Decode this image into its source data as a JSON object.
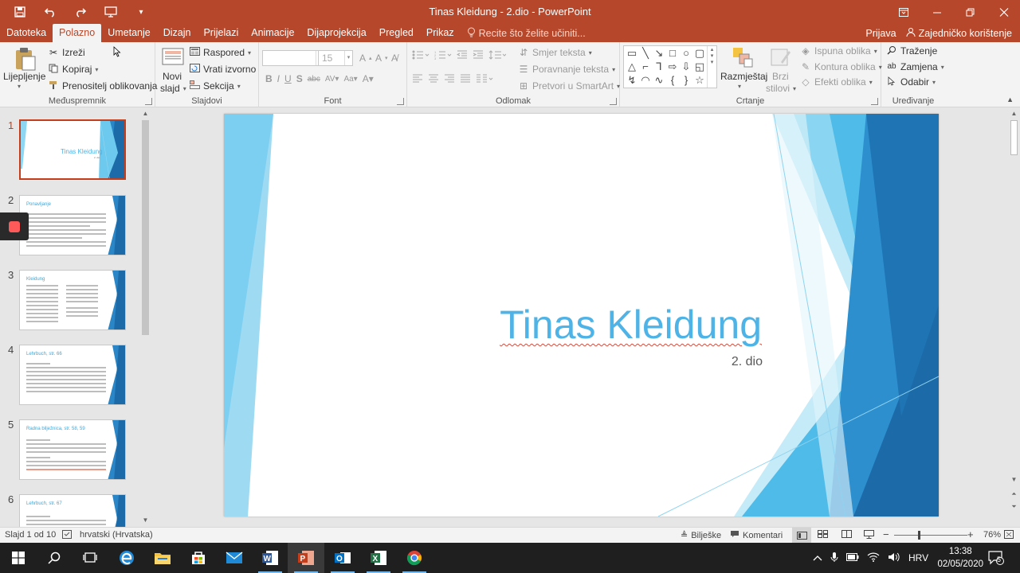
{
  "titlebar": {
    "title": "Tinas Kleidung - 2.dio - PowerPoint",
    "qat": [
      "save-icon",
      "undo-icon",
      "redo-icon",
      "present-icon",
      "customize-icon"
    ]
  },
  "tabs": [
    "Datoteka",
    "Polazno",
    "Umetanje",
    "Dizajn",
    "Prijelazi",
    "Animacije",
    "Dijaprojekcija",
    "Pregled",
    "Prikaz"
  ],
  "active_tab": "Polazno",
  "tellme": "Recite što želite učiniti...",
  "account": {
    "signin": "Prijava",
    "share": "Zajedničko korištenje"
  },
  "ribbon": {
    "clipboard": {
      "paste": "Lijepljenje",
      "cut": "Izreži",
      "copy": "Kopiraj",
      "format_painter": "Prenositelj oblikovanja",
      "label": "Međuspremnik"
    },
    "slides": {
      "new_slide_1": "Novi",
      "new_slide_2": "slajd",
      "layout": "Raspored",
      "reset": "Vrati izvorno",
      "section": "Sekcija",
      "label": "Slajdovi"
    },
    "font": {
      "size": "15",
      "label": "Font"
    },
    "paragraph": {
      "text_direction": "Smjer teksta",
      "align_text": "Poravnanje teksta",
      "smartart": "Pretvori u SmartArt",
      "label": "Odlomak"
    },
    "drawing": {
      "arrange": "Razmještaj",
      "quick_styles_1": "Brzi",
      "quick_styles_2": "stilovi",
      "shape_fill": "Ispuna oblika",
      "shape_outline": "Kontura oblika",
      "shape_effects": "Efekti oblika",
      "label": "Crtanje"
    },
    "editing": {
      "find": "Traženje",
      "replace": "Zamjena",
      "select": "Odabir",
      "label": "Uređivanje"
    }
  },
  "thumbnails": [
    {
      "num": "1",
      "title": "Tinas Kleidung",
      "sub": "2. dio"
    },
    {
      "num": "2",
      "title": "Ponavljanje"
    },
    {
      "num": "3",
      "title": "Kleidung"
    },
    {
      "num": "4",
      "title": "Lehrbuch, str. 66"
    },
    {
      "num": "5",
      "title": "Radna bilježnica, str. 58, 59"
    },
    {
      "num": "6",
      "title": "Lehrbuch, str. 67"
    }
  ],
  "slide": {
    "title": "Tinas Kleidung",
    "subtitle": "2. dio"
  },
  "status": {
    "slide_info": "Slajd 1 od 10",
    "language": "hrvatski (Hrvatska)",
    "notes": "Bilješke",
    "comments": "Komentari",
    "zoom": "76%"
  },
  "taskbar": {
    "language": "HRV",
    "time": "13:38",
    "date": "02/05/2020",
    "notifications": "5"
  },
  "colors": {
    "accent": "#b7472a",
    "slide_title": "#4eb3e6"
  }
}
